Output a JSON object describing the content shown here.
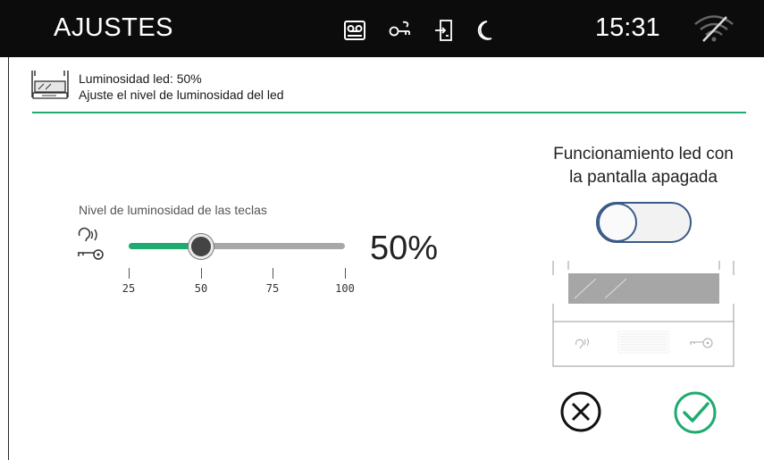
{
  "topbar": {
    "title": "AJUSTES",
    "clock": "15:31",
    "status_icons": [
      "voicemail-icon",
      "key-icon",
      "door-exit-icon",
      "moon-icon"
    ],
    "wifi_icon": "wifi-off-icon"
  },
  "header": {
    "icon": "led-strip-icon",
    "line1": "Luminosidad led: 50%",
    "line2": "Ajuste el nivel de luminosidad del led"
  },
  "slider": {
    "label": "Nivel de luminosidad de las teclas",
    "value_percent": 50,
    "value_text": "50%",
    "min": 25,
    "max": 100,
    "ticks": [
      "25",
      "50",
      "75",
      "100"
    ]
  },
  "led_off": {
    "title_line1": "Funcionamiento led con",
    "title_line2": "la pantalla apagada",
    "toggle_on": false
  },
  "colors": {
    "accent": "#1faa6f",
    "topbar": "#0c0c0c",
    "toggle_border": "#3a5a88"
  }
}
